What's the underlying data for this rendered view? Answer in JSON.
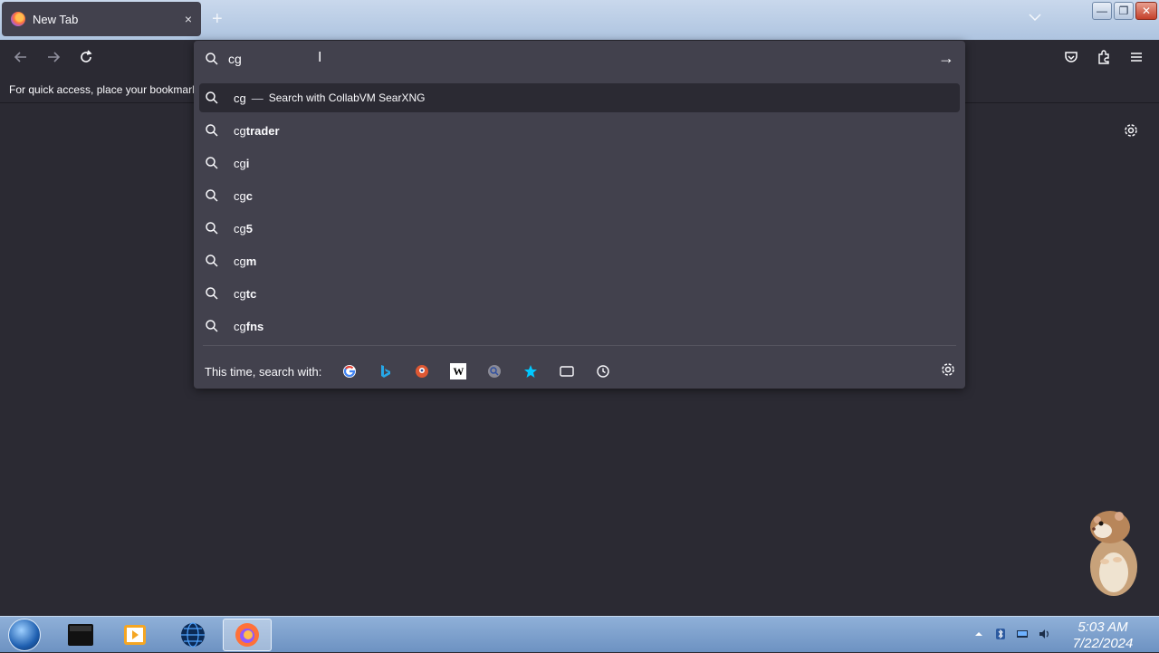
{
  "tab": {
    "title": "New Tab",
    "close": "×"
  },
  "newtab_label": "+",
  "window_controls": {
    "minimize": "—",
    "maximize": "❐",
    "close": "✕"
  },
  "urlbar": {
    "value": "cg",
    "go": "→"
  },
  "bookmarks_hint": "For quick access, place your bookmark",
  "suggestions": {
    "first": {
      "query": "cg",
      "sep": "—",
      "action": "Search with CollabVM SearXNG"
    },
    "items": [
      {
        "prefix": "cg",
        "rest": "trader"
      },
      {
        "prefix": "cg",
        "rest": "i"
      },
      {
        "prefix": "cg",
        "rest": "c"
      },
      {
        "prefix": "cg",
        "rest": "5"
      },
      {
        "prefix": "cg",
        "rest": "m"
      },
      {
        "prefix": "cg",
        "rest": "tc"
      },
      {
        "prefix": "cg",
        "rest": "fns"
      }
    ]
  },
  "oneoff": {
    "label": "This time, search with:",
    "wikipedia_glyph": "W"
  },
  "icons": [
    "firefox-icon",
    "search-icon",
    "back-icon",
    "forward-icon",
    "reload-icon",
    "pocket-icon",
    "extensions-icon",
    "menu-icon",
    "gear-icon",
    "google-icon",
    "bing-icon",
    "duckduckgo-icon",
    "wikipedia-icon",
    "searxng-icon",
    "bookmarks-icon",
    "tabs-icon",
    "history-icon",
    "hamster-sticker"
  ],
  "taskbar": {
    "time": "5:03 AM",
    "date": "7/22/2024"
  },
  "colors": {
    "panel": "#42414d",
    "page": "#2b2a33",
    "text": "#fbfbfe",
    "taskbar": "#6d92c2"
  }
}
